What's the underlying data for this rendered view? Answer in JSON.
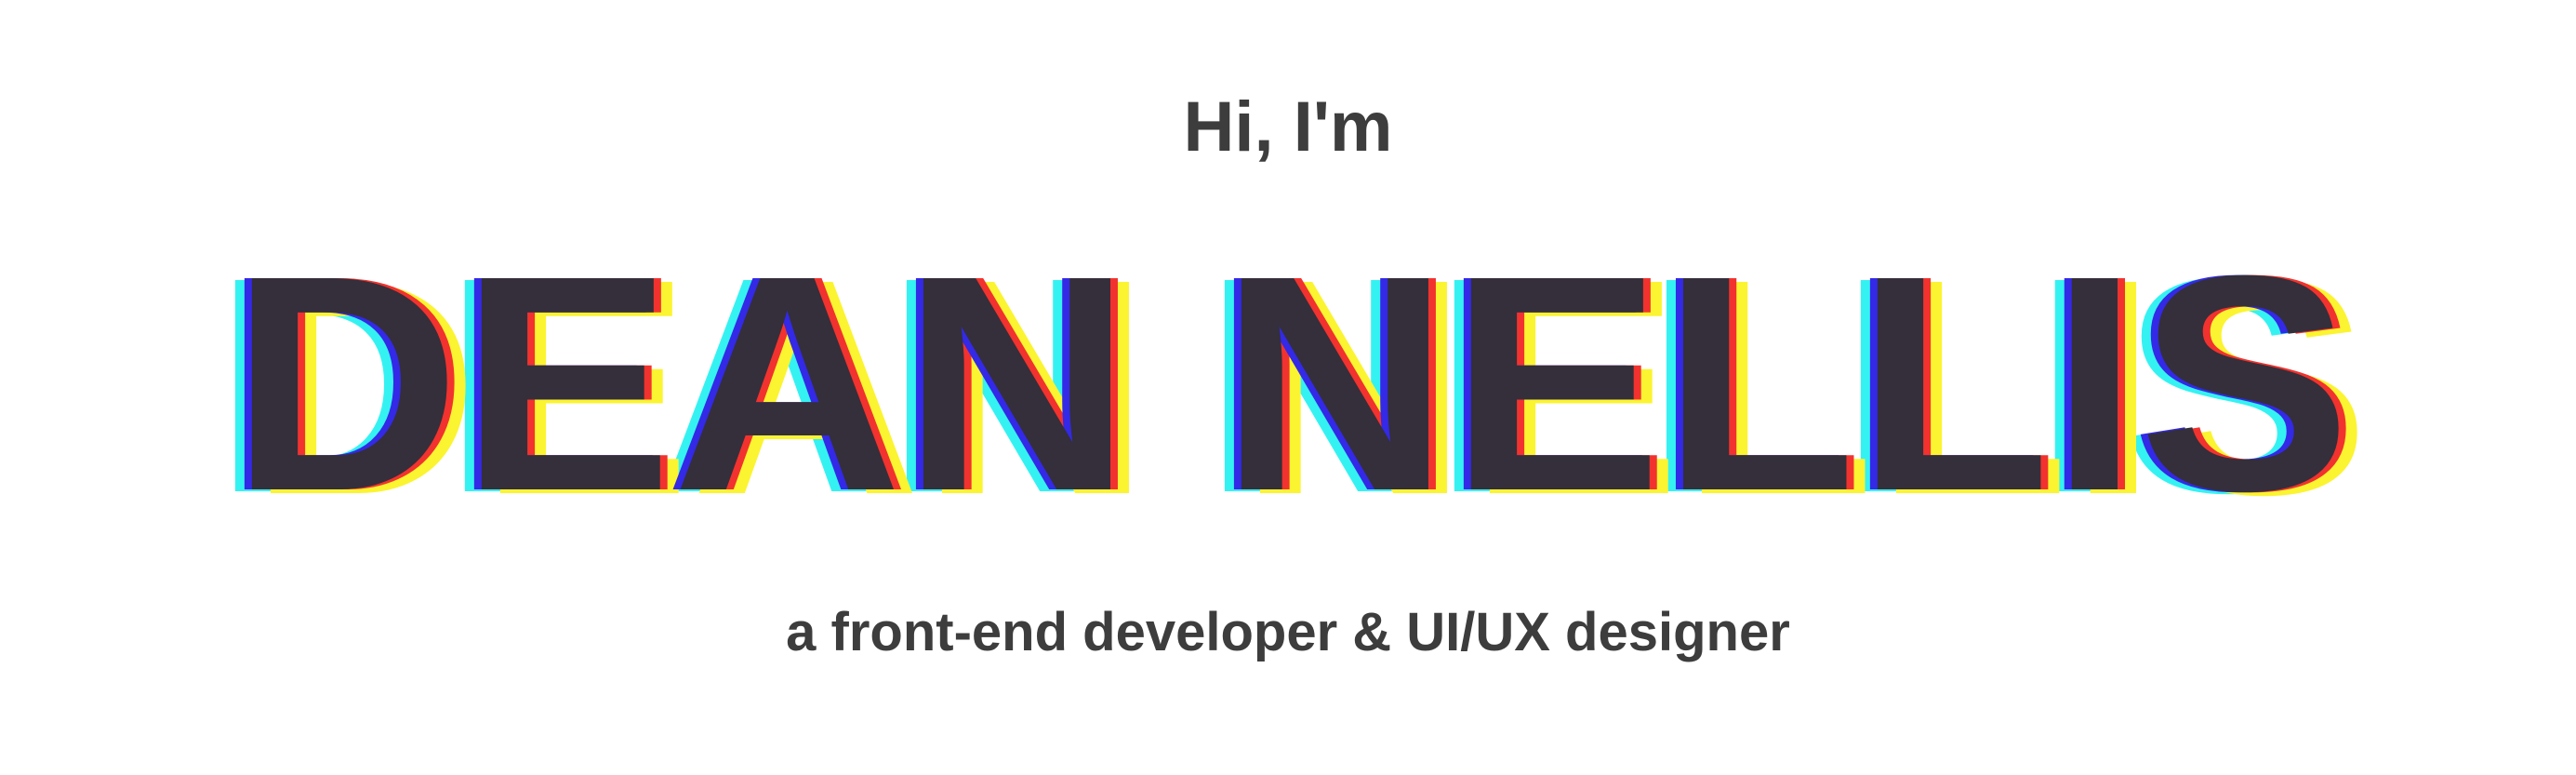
{
  "hero": {
    "greeting": "Hi, I'm",
    "name": "DEAN NELLIS",
    "tagline": "a front-end developer & UI/UX designer"
  },
  "colors": {
    "background": "#ffffff",
    "text": "#3d3d3d",
    "name_fill": "#342f3a",
    "glitch_cyan": "#35f2f2",
    "glitch_yellow": "#fbf430",
    "glitch_red": "#f2322e",
    "glitch_blue": "#3329e6"
  }
}
